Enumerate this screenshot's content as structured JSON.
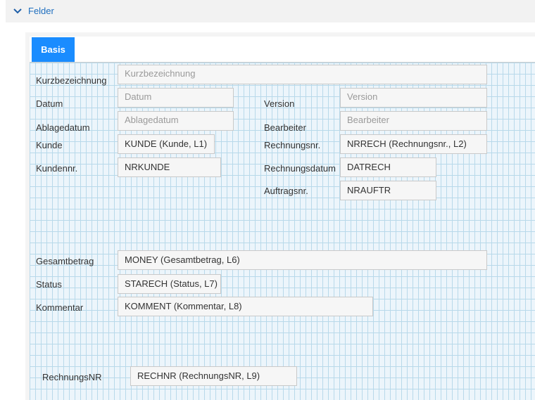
{
  "section": {
    "title": "Felder"
  },
  "tabs": [
    {
      "label": "Basis"
    }
  ],
  "fields": {
    "kurzbezeichnung": {
      "label": "Kurzbezeichnung",
      "placeholder": "Kurzbezeichnung"
    },
    "datum": {
      "label": "Datum",
      "placeholder": "Datum"
    },
    "version": {
      "label": "Version",
      "placeholder": "Version"
    },
    "ablagedatum": {
      "label": "Ablagedatum",
      "placeholder": "Ablagedatum"
    },
    "bearbeiter": {
      "label": "Bearbeiter",
      "placeholder": "Bearbeiter"
    },
    "kunde": {
      "label": "Kunde",
      "value": "KUNDE (Kunde, L1)"
    },
    "rechnungsnr": {
      "label": "Rechnungsnr.",
      "value": "NRRECH (Rechnungsnr., L2)"
    },
    "kundennr": {
      "label": "Kundennr.",
      "value": "NRKUNDE"
    },
    "rechnungsdatum": {
      "label": "Rechnungsdatum",
      "value": "DATRECH"
    },
    "auftragsnr": {
      "label": "Auftragsnr.",
      "value": "NRAUFTR"
    },
    "gesamtbetrag": {
      "label": "Gesamtbetrag",
      "value": "MONEY (Gesamtbetrag, L6)"
    },
    "status": {
      "label": "Status",
      "value": "STARECH (Status, L7)"
    },
    "kommentar": {
      "label": "Kommentar",
      "value": "KOMMENT (Kommentar, L8)"
    },
    "rechnungsnr_field": {
      "label": "RechnungsNR",
      "value": "RECHNR (RechnungsNR, L9)"
    }
  }
}
